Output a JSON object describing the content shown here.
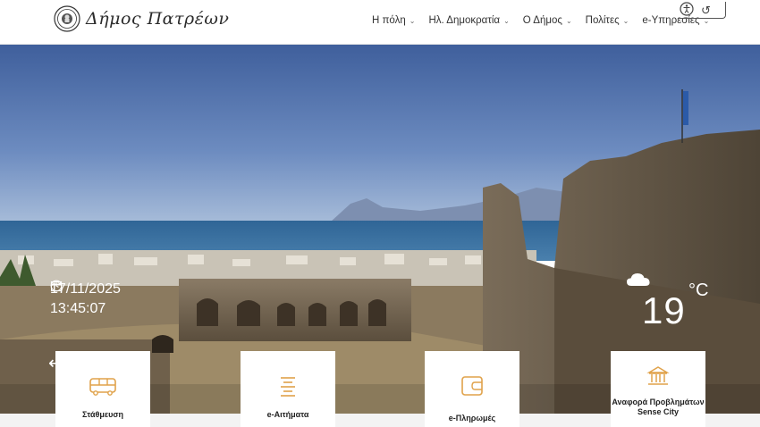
{
  "header": {
    "logo_text": "Δήμος Πατρέων",
    "nav": [
      {
        "label": "Η πόλη"
      },
      {
        "label": "Ηλ. Δημοκρατία"
      },
      {
        "label": "Ο Δήμος"
      },
      {
        "label": "Πολίτες"
      },
      {
        "label": "e-Υπηρεσίες"
      }
    ],
    "chevron": "⌄"
  },
  "hero": {
    "date": "17/11/2025",
    "time": "13:45:07",
    "temperature": "19",
    "temperature_unit": "°C",
    "prev_arrow": "⟵",
    "next_arrow": "⟶"
  },
  "cards": [
    {
      "label": "Στάθμευση",
      "icon": "bus-icon"
    },
    {
      "label": "e-Αιτήματα",
      "icon": "list-icon"
    },
    {
      "label": "e-Πληρωμές",
      "icon": "wallet-icon"
    },
    {
      "label": "Αναφορά Προβλημάτων Sense City",
      "icon": "building-icon"
    }
  ],
  "colors": {
    "accent": "#e0a24a",
    "sky": "#4e6fa8",
    "sea": "#3b6ea0"
  }
}
